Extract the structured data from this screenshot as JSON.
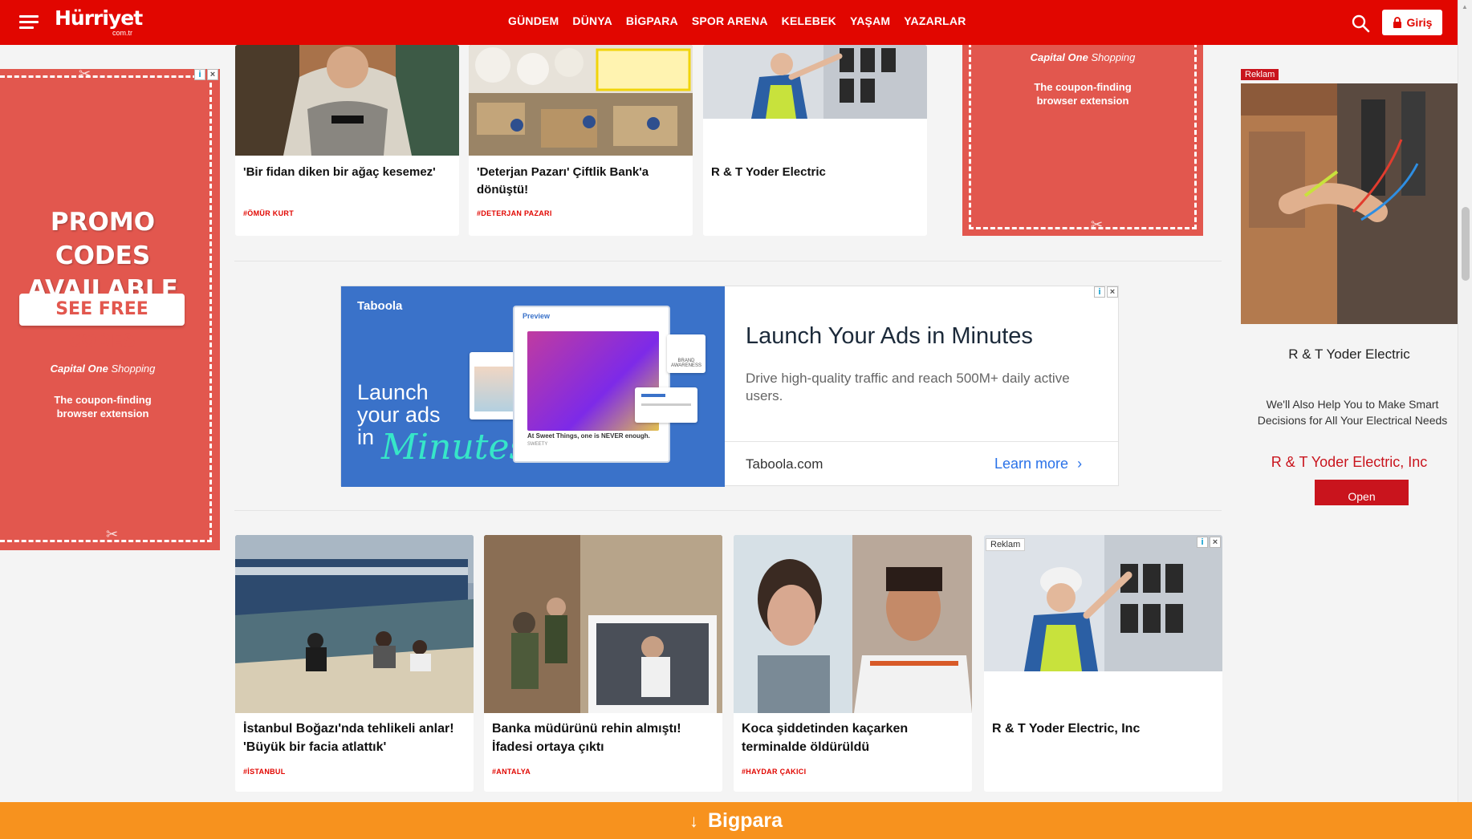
{
  "header": {
    "logo": "Hürriyet",
    "logo_sub": "com.tr",
    "nav": [
      "GÜNDEM",
      "DÜNYA",
      "BİGPARA",
      "SPOR ARENA",
      "KELEBEK",
      "YAŞAM",
      "YAZARLAR"
    ],
    "login_label": "Giriş",
    "brand_color": "#e10600"
  },
  "left_ad": {
    "headline_1": "PROMO CODES",
    "headline_2": "AVAILABLE",
    "button": "SEE FREE CODES",
    "brand": "Capital One",
    "brand_suffix": "Shopping",
    "tagline_1": "The coupon-finding",
    "tagline_2": "browser extension",
    "bg_color": "#e2574e"
  },
  "top_cards": [
    {
      "title": "'Bir fidan diken bir ağaç kesemez'",
      "tag": "#ÖMÜR KURT"
    },
    {
      "title": "'Deterjan Pazarı' Çiftlik Bank'a dönüştü!",
      "tag": "#DETERJAN PAZARI"
    },
    {
      "title": "R & T Yoder Electric",
      "tag": ""
    }
  ],
  "small_ad": {
    "brand": "Capital One",
    "brand_suffix": "Shopping",
    "tagline_1": "The coupon-finding",
    "tagline_2": "browser extension"
  },
  "taboola": {
    "logo": "Taboola",
    "launch_text_1": "Launch",
    "launch_text_2": "your ads",
    "launch_text_3": "in",
    "launch_text_minutes": "Minutes",
    "preview_label": "Preview",
    "preview_caption": "At Sweet Things, one is NEVER enough.",
    "preview_sub": "SWEETY",
    "brand_awareness": "BRAND AWARENESS",
    "headline": "Launch Your Ads in Minutes",
    "description": "Drive high-quality traffic and reach 500M+ daily active users.",
    "domain": "Taboola.com",
    "cta": "Learn more"
  },
  "bottom_cards": [
    {
      "title": "İstanbul Boğazı'nda tehlikeli anlar! 'Büyük bir facia atlattık'",
      "tag": "#İSTANBUL"
    },
    {
      "title": "Banka müdürünü rehin almıştı! İfadesi ortaya çıktı",
      "tag": "#ANTALYA"
    },
    {
      "title": "Koca şiddetinden kaçarken terminalde öldürüldü",
      "tag": "#HAYDAR ÇAKICI"
    },
    {
      "title": "R & T Yoder Electric, Inc",
      "tag": "",
      "badge": "Reklam"
    }
  ],
  "side_ad": {
    "badge": "Reklam",
    "name": "R & T Yoder Electric",
    "description": "We'll Also Help You to Make Smart Decisions for All Your Electrical Needs",
    "company": "R & T Yoder Electric, Inc",
    "button": "Open"
  },
  "bottom_bar": {
    "label": "Bigpara",
    "color": "#f7921e"
  }
}
